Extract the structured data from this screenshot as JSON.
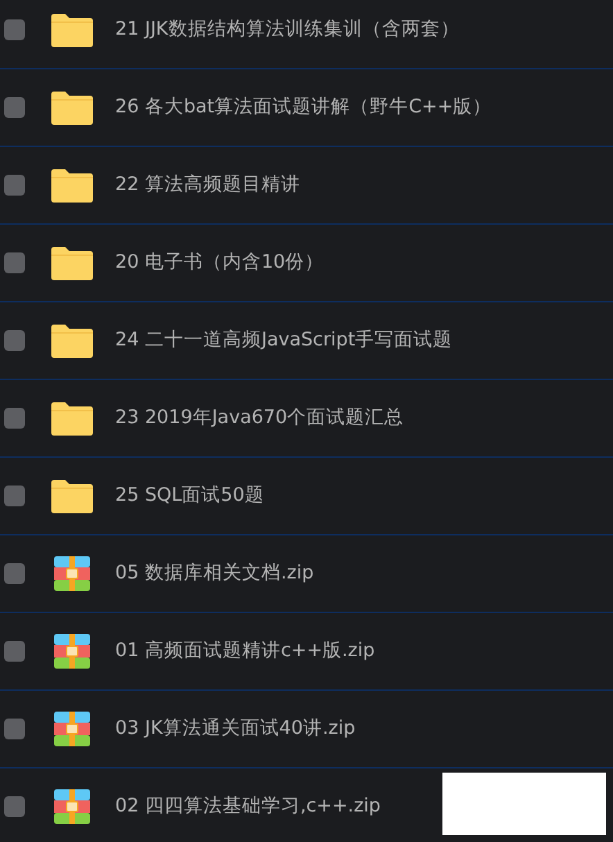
{
  "files": [
    {
      "kind": "folder",
      "name": "21 JJK数据结构算法训练集训（含两套）",
      "checked": false
    },
    {
      "kind": "folder",
      "name": "26 各大bat算法面试题讲解（野牛C++版）",
      "checked": false
    },
    {
      "kind": "folder",
      "name": "22 算法高频题目精讲",
      "checked": false
    },
    {
      "kind": "folder",
      "name": "20 电子书（内含10份）",
      "checked": false
    },
    {
      "kind": "folder",
      "name": "24 二十一道高频JavaScript手写面试题",
      "checked": false
    },
    {
      "kind": "folder",
      "name": "23 2019年Java670个面试题汇总",
      "checked": false
    },
    {
      "kind": "folder",
      "name": "25 SQL面试50题",
      "checked": false
    },
    {
      "kind": "zip",
      "name": "05 数据库相关文档.zip",
      "checked": false
    },
    {
      "kind": "zip",
      "name": "01 高频面试题精讲c++版.zip",
      "checked": false
    },
    {
      "kind": "zip",
      "name": "03 JK算法通关面试40讲.zip",
      "checked": false
    },
    {
      "kind": "zip",
      "name": "02 四四算法基础学习,c++.zip",
      "checked": false
    }
  ]
}
